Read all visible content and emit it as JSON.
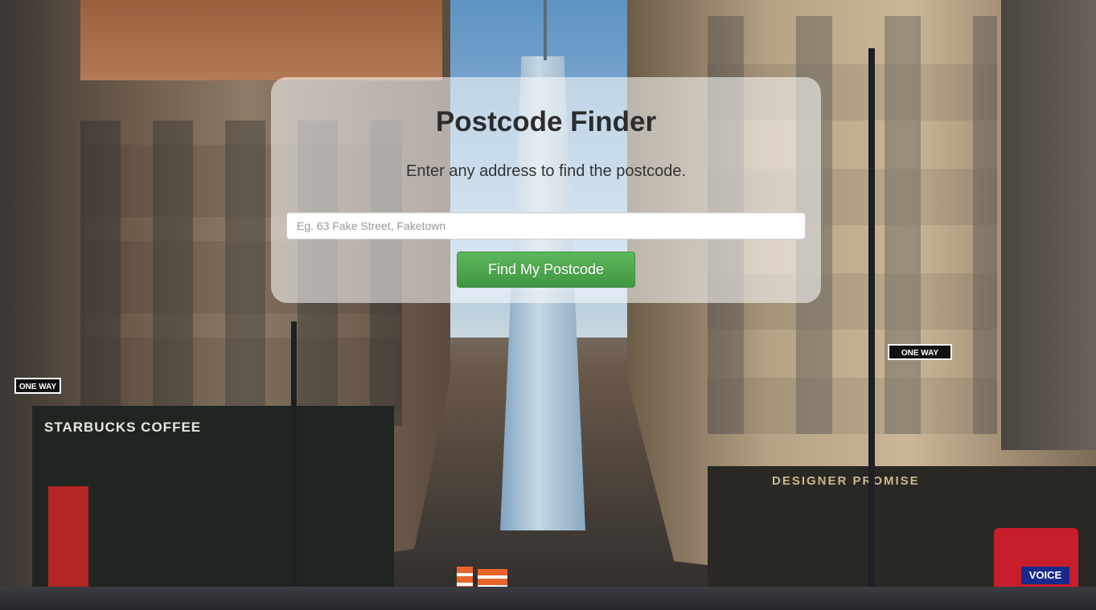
{
  "background": {
    "description_scene": "city-street",
    "store_sign_left": "STARBUCKS COFFEE",
    "store_sign_right": "DESIGNER PROMISE",
    "street_sign_1": "ONE WAY",
    "street_sign_2": "ONE WAY",
    "mailbox_label": "VOICE"
  },
  "card": {
    "title": "Postcode Finder",
    "subtitle": "Enter any address to find the postcode.",
    "input": {
      "value": "",
      "placeholder": "Eg. 63 Fake Street, Faketown"
    },
    "button_label": "Find My Postcode"
  },
  "colors": {
    "button": "#5cb85c",
    "card_bg": "rgba(255,255,255,0.55)",
    "title_text": "#2c2c2c"
  }
}
